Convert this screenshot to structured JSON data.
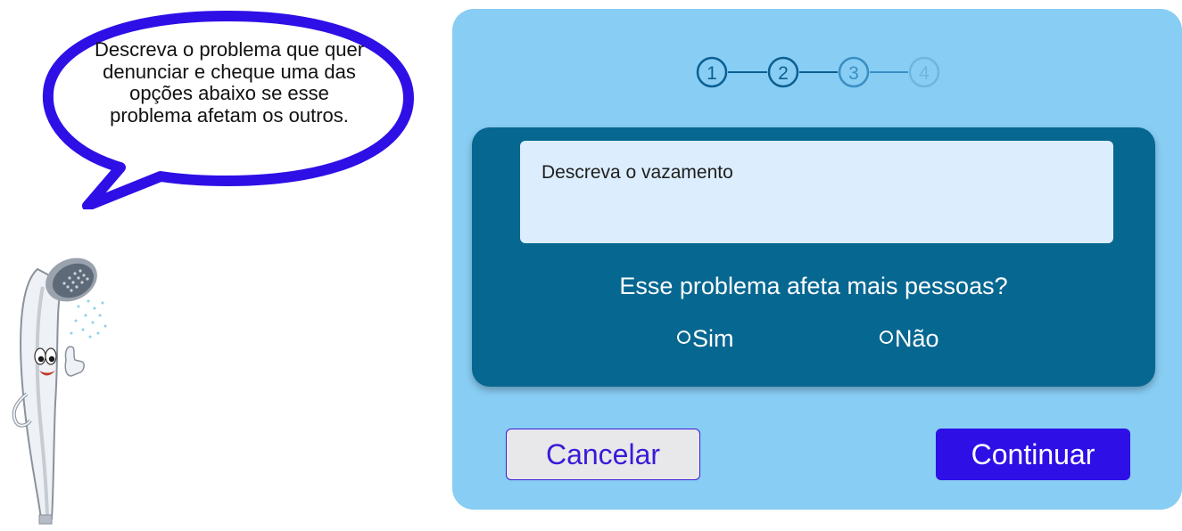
{
  "bubble": {
    "text": "Descreva o problema que quer denunciar e cheque uma das opções abaixo se esse problema afetam os outros."
  },
  "stepper": {
    "steps": [
      {
        "label": "1",
        "state": "active"
      },
      {
        "label": "2",
        "state": "active"
      },
      {
        "label": "3",
        "state": "upcoming"
      },
      {
        "label": "4",
        "state": "upcoming"
      }
    ],
    "colors": {
      "active": "#0b5f91",
      "step3": "#3a8fc3",
      "step4": "#6fb6df"
    }
  },
  "form": {
    "description_placeholder": "Descreva o vazamento",
    "question": "Esse problema afeta mais pessoas?",
    "options": [
      {
        "label": "Sim",
        "selected": false
      },
      {
        "label": "Não",
        "selected": false
      }
    ]
  },
  "actions": {
    "cancel_label": "Cancelar",
    "continue_label": "Continuar"
  },
  "colors": {
    "panel_bg": "#88cdf4",
    "card_bg": "#066791",
    "field_bg": "#dcedfd",
    "bubble_border": "#2e10e6",
    "primary_button": "#2e10e6"
  }
}
